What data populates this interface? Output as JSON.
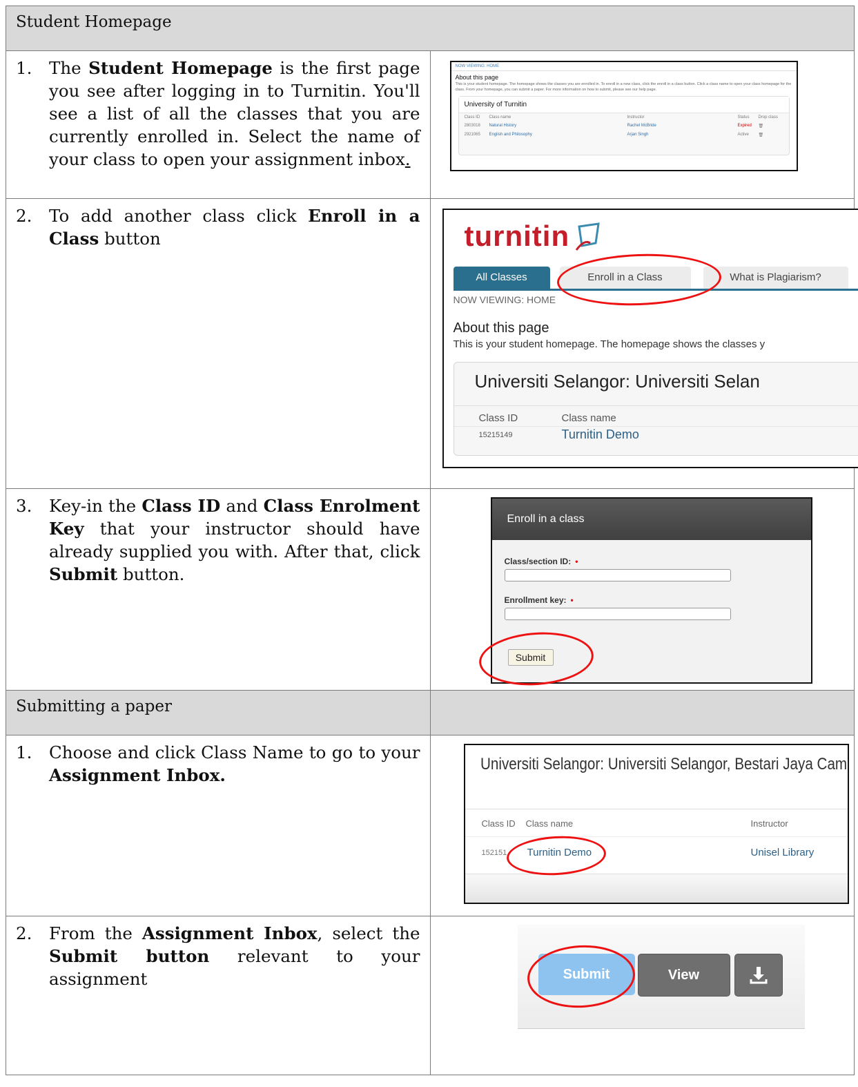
{
  "section1": {
    "title": "Student Homepage"
  },
  "row1": {
    "number": "1.",
    "text_a": "The ",
    "bold_a": "Student Homepage",
    "text_b": " is the first page you see after logging in to Turnitin. You'll see a list of all the classes that you are currently enrolled in. Select the name of your class to open your assignment inbox",
    "underlined": ".",
    "screenshot": {
      "now_viewing": "NOW VIEWING: HOME",
      "about_heading": "About this page",
      "about_text": "This is your student homepage. The homepage shows the classes you are enrolled in. To enroll in a new class, click the enroll in a class button. Click a class name to open your class homepage for the class. From your homepage, you can submit a paper. For more information on how to submit, please see our help page.",
      "panel_title": "University of Turnitin",
      "columns": [
        "Class ID",
        "Class name",
        "Instructor",
        "Status",
        "Drop class"
      ],
      "rows": [
        {
          "id": "2803018",
          "name": "Natural History",
          "instructor": "Rachel McBride",
          "status": "Expired"
        },
        {
          "id": "2921065",
          "name": "English and Philosophy",
          "instructor": "Arjan Singh",
          "status": "Active"
        }
      ]
    }
  },
  "row2": {
    "number": "2.",
    "text_a": "To add another class click ",
    "bold_a": "Enroll in a Class",
    "text_b": " button",
    "screenshot": {
      "logo": "turnitin",
      "tabs": [
        "All Classes",
        "Enroll in a Class",
        "What is Plagiarism?"
      ],
      "now_viewing": "NOW VIEWING: HOME",
      "about_heading": "About this page",
      "about_text": "This is your student homepage. The homepage shows the classes y",
      "panel_title": "Universiti Selangor: Universiti Selan",
      "col_id": "Class ID",
      "col_name": "Class name",
      "row_id": "15215149",
      "row_name": "Turnitin Demo"
    }
  },
  "row3": {
    "number": "3.",
    "text_a": "Key-in the ",
    "bold_a": "Class ID",
    "text_b": " and ",
    "bold_b": "Class Enrolment Key",
    "text_c": " that your instructor should have already supplied you with. After that, click ",
    "bold_c": "Submit",
    "text_d": " button.",
    "screenshot": {
      "title": "Enroll in a class",
      "label_id": "Class/section ID:",
      "label_key": "Enrollment key:",
      "required": "•",
      "submit": "Submit"
    }
  },
  "section2": {
    "title": "Submitting a paper"
  },
  "row4": {
    "number": "1.",
    "text_a": "Choose and click Class Name to go to your ",
    "bold_a": "Assignment Inbox.",
    "screenshot": {
      "panel_title": "Universiti Selangor: Universiti Selangor, Bestari Jaya Campus",
      "col_id": "Class ID",
      "col_name": "Class name",
      "col_instructor": "Instructor",
      "row_id": "152151",
      "row_name": "Turnitin Demo",
      "row_instructor": "Unisel Library"
    }
  },
  "row5": {
    "number": "2.",
    "text_a": "From the ",
    "bold_a": "Assignment Inbox",
    "text_b": ", select the ",
    "bold_b": "Submit button",
    "text_c": " relevant to your assignment",
    "screenshot": {
      "submit": "Submit",
      "view": "View",
      "download_icon": "download-icon"
    }
  },
  "colors": {
    "header_bg": "#d9d9d9",
    "highlight": "#ee1111",
    "turnitin_red": "#c41e2b",
    "tab_blue": "#2b6f8e"
  }
}
